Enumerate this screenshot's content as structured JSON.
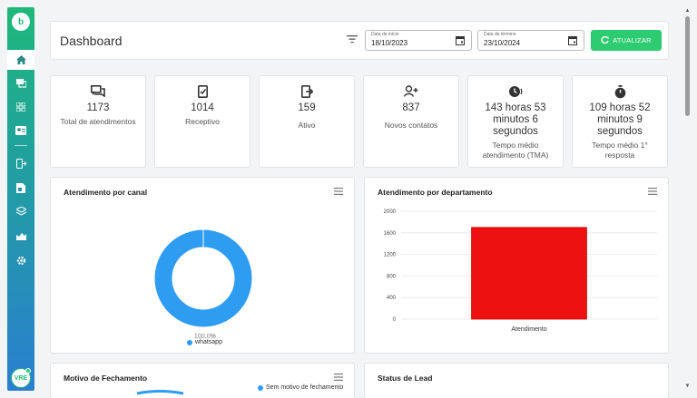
{
  "sidebar": {
    "logo": "b",
    "items": [
      {
        "icon": "home-icon",
        "active": true
      },
      {
        "icon": "chat-icon"
      },
      {
        "icon": "grid-icon"
      },
      {
        "icon": "contact-card-icon"
      },
      {
        "icon": "phone-exit-icon"
      },
      {
        "icon": "document-icon"
      },
      {
        "icon": "layers-icon"
      },
      {
        "icon": "chart-icon"
      },
      {
        "icon": "gear-icon"
      }
    ],
    "avatar_initials": "VRE"
  },
  "header": {
    "title": "Dashboard",
    "start_label": "Data de início",
    "start_value": "18/10/2023",
    "end_label": "Data de término",
    "end_value": "23/10/2024",
    "update_button": "ATUALIZAR"
  },
  "stats": [
    {
      "value": "1173",
      "label": "Total de atendimentos",
      "icon": "chat-bubbles-icon"
    },
    {
      "value": "1014",
      "label": "Receptivo",
      "icon": "phone-check-icon"
    },
    {
      "value": "159",
      "label": "Ativo",
      "icon": "phone-exit-icon"
    },
    {
      "value": "837",
      "label": "Novos contatos",
      "icon": "add-user-icon"
    },
    {
      "value": "143 horas 53 minutos 6 segundos",
      "label": "Tempo médio atendimento (TMA)",
      "icon": "clock-icon"
    },
    {
      "value": "109 horas 52 minutos 9 segundos",
      "label": "Tempo médio 1° resposta",
      "icon": "stopwatch-icon"
    }
  ],
  "charts": {
    "canal": {
      "title": "Atendimento por canal",
      "center_label": "100.0%",
      "legend": "whatsapp"
    },
    "departamento": {
      "title": "Atendimento por departamento"
    },
    "fechamento": {
      "title": "Motivo de Fechamento",
      "legend": "Sem motivo de fechamento"
    },
    "lead": {
      "title": "Status de Lead"
    }
  },
  "colors": {
    "accent": "#2ecc71",
    "donut": "#2e9cf0",
    "bar": "#ee1111"
  },
  "chart_data": [
    {
      "type": "pie",
      "title": "Atendimento por canal",
      "categories": [
        "whatsapp"
      ],
      "values": [
        100.0
      ]
    },
    {
      "type": "bar",
      "title": "Atendimento por departamento",
      "categories": [
        "Atendimento"
      ],
      "values": [
        1700
      ],
      "ylim": [
        0,
        2000
      ],
      "yticks": [
        "2000",
        "1600",
        "1200",
        "800",
        "400",
        "0"
      ],
      "grid": true
    }
  ]
}
